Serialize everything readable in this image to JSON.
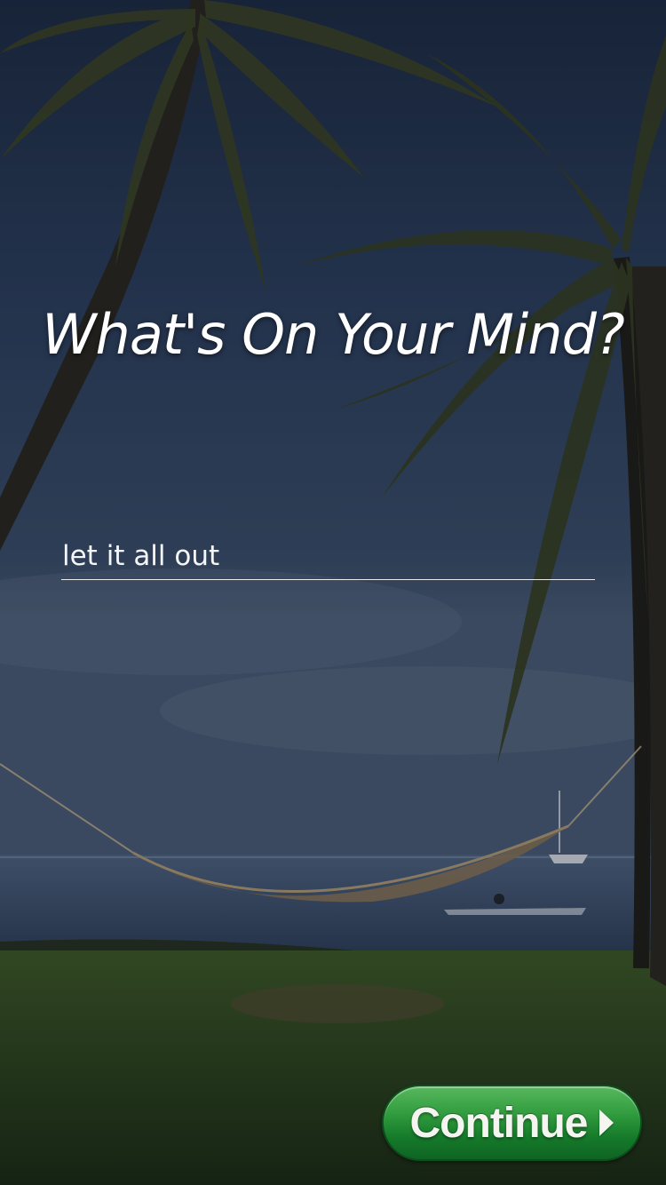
{
  "screen": {
    "title": "What's On Your Mind?",
    "input": {
      "value": "",
      "placeholder": "let it all out"
    },
    "continue_button": {
      "label": "Continue",
      "icon": "chevron-right-icon"
    }
  },
  "colors": {
    "sky": "#2c3f58",
    "sea": "#3d5572",
    "grass": "#2f4a1e",
    "button_green": "#1f8a33",
    "text": "#ffffff"
  },
  "background": {
    "description_icon": "beach-palm-hammock-background"
  }
}
